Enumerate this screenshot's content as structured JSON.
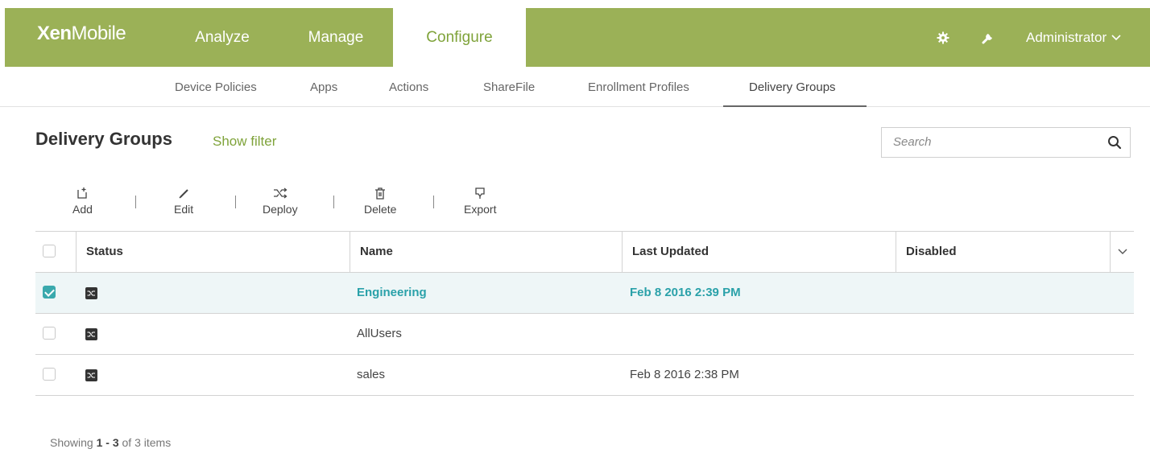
{
  "app": {
    "logo_bold": "Xen",
    "logo_light": "Mobile",
    "brand_color": "#9bb157",
    "accent_color": "#7fa33a",
    "selection_color": "#2aa1a9"
  },
  "topnav": {
    "tabs": [
      {
        "label": "Analyze"
      },
      {
        "label": "Manage"
      },
      {
        "label": "Configure",
        "active": true
      }
    ],
    "settings_icon": "gear-icon",
    "tools_icon": "wrench-icon",
    "user_label": "Administrator"
  },
  "subnav": {
    "items": [
      {
        "label": "Device Policies"
      },
      {
        "label": "Apps"
      },
      {
        "label": "Actions"
      },
      {
        "label": "ShareFile"
      },
      {
        "label": "Enrollment Profiles"
      },
      {
        "label": "Delivery Groups",
        "active": true
      }
    ]
  },
  "page": {
    "title": "Delivery Groups",
    "show_filter": "Show filter",
    "search_placeholder": "Search"
  },
  "toolbar": {
    "add": "Add",
    "edit": "Edit",
    "deploy": "Deploy",
    "delete": "Delete",
    "export": "Export"
  },
  "table": {
    "columns": [
      "Status",
      "Name",
      "Last Updated",
      "Disabled"
    ],
    "rows": [
      {
        "selected": true,
        "name": "Engineering",
        "last_updated": "Feb 8 2016 2:39 PM",
        "disabled": ""
      },
      {
        "selected": false,
        "name": "AllUsers",
        "last_updated": "",
        "disabled": ""
      },
      {
        "selected": false,
        "name": "sales",
        "last_updated": "Feb 8 2016 2:38 PM",
        "disabled": ""
      }
    ]
  },
  "footer": {
    "prefix": "Showing ",
    "range": "1 - 3",
    "of": " of 3 items"
  }
}
